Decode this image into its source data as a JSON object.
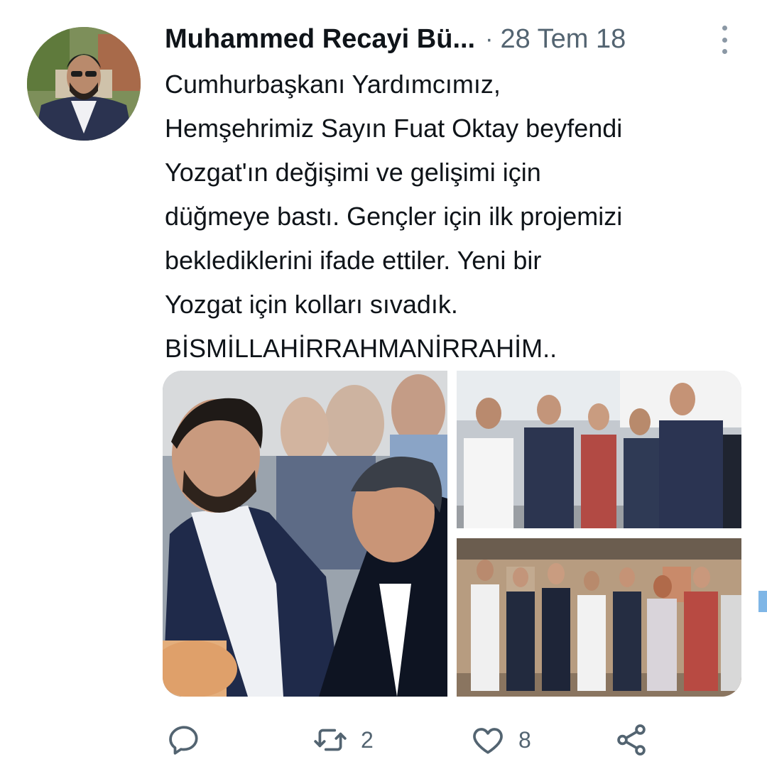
{
  "tweet": {
    "author": "Muhammed Recayi Bü...",
    "separator": "·",
    "date": "28 Tem 18",
    "text_lines": [
      "Cumhurbaşkanı Yardımcımız,",
      "Hemşehrimiz Sayın Fuat Oktay beyfendi",
      "Yozgat'ın değişimi ve gelişimi için",
      "düğmeye bastı. Gençler için ilk projemizi",
      "beklediklerini ifade ettiler. Yeni bir",
      "Yozgat için kolları sıvadık.",
      "BİSMİLLAHİRRAHMANİRRAHİM.."
    ]
  },
  "actions": {
    "reply": {
      "icon": "reply-icon",
      "count": ""
    },
    "retweet": {
      "icon": "retweet-icon",
      "count": "2"
    },
    "like": {
      "icon": "heart-icon",
      "count": "8"
    },
    "share": {
      "icon": "share-icon"
    }
  },
  "colors": {
    "text": "#0f1419",
    "secondary": "#536471",
    "icon": "#536471",
    "background": "#ffffff"
  }
}
